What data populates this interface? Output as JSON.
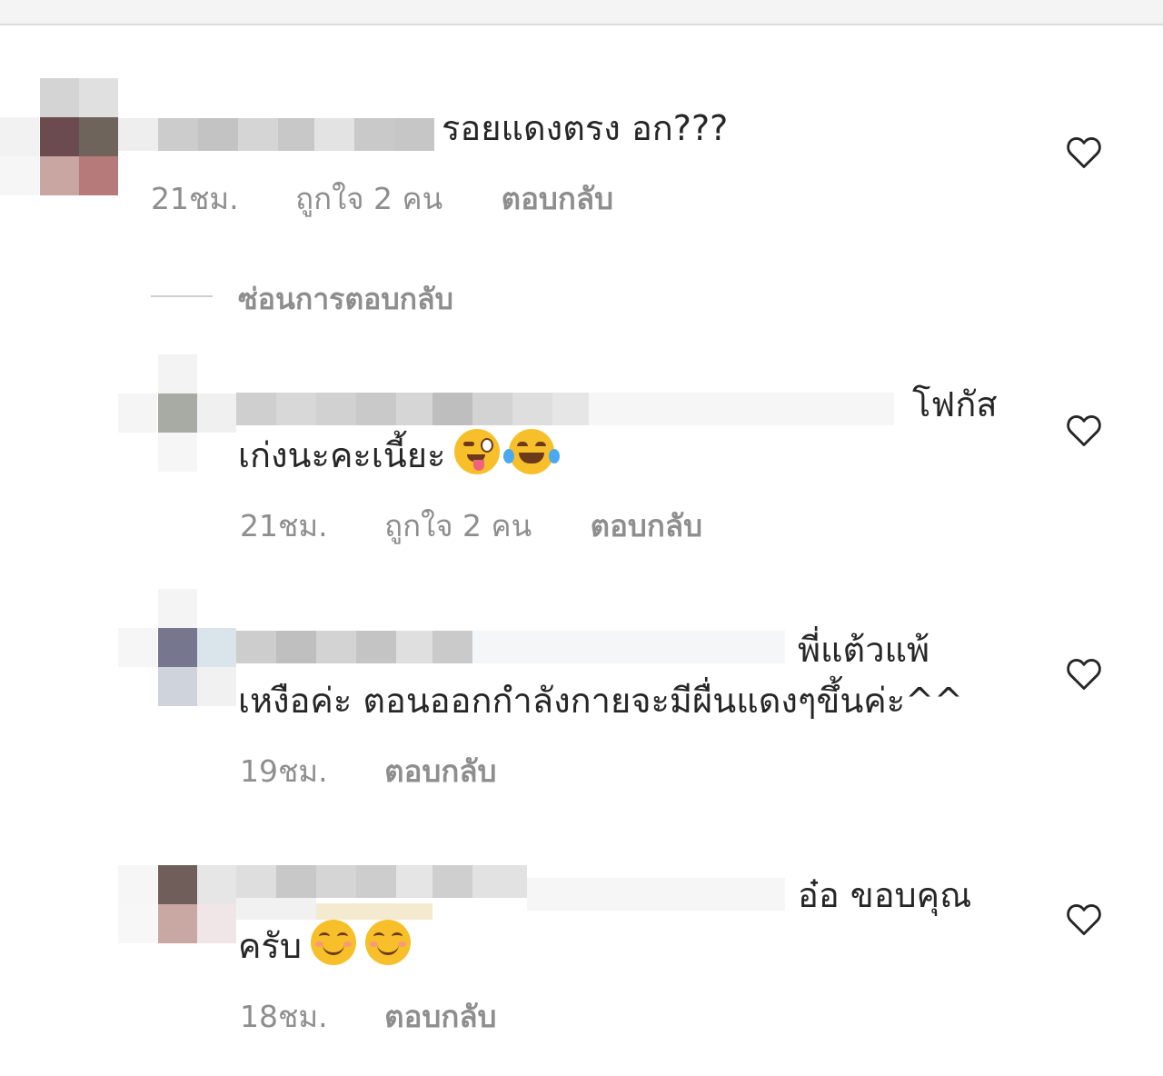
{
  "colors": {
    "text": "#262626",
    "meta": "#8e8e8e",
    "divider": "#cfcfcf",
    "emoji_yellow": "#f7c02a"
  },
  "comments": [
    {
      "text_line1": "รอยแดงตรง อก???",
      "text_line2": "",
      "time": "21ชม.",
      "likes": "ถูกใจ 2 คน",
      "reply": "ตอบกลับ",
      "like_icon": "heart-outline-icon"
    }
  ],
  "hide_replies": "ซ่อนการตอบกลับ",
  "replies": [
    {
      "text_line1": "โฟกัส",
      "text_line2": "เก่งนะคะเนี้ยะ",
      "emojis": [
        "winking-face-with-tongue",
        "face-with-tears-of-joy"
      ],
      "time": "21ชม.",
      "likes": "ถูกใจ 2 คน",
      "reply": "ตอบกลับ"
    },
    {
      "text_line1": "พี่แต้วแพ้",
      "text_line2": "เหงือค่ะ  ตอนออกกำลังกายจะมีผื่นแดงๆขึ้นค่ะ^^",
      "emojis": [],
      "time": "19ชม.",
      "likes": "",
      "reply": "ตอบกลับ"
    },
    {
      "text_line1": "อ๋อ ขอบคุณ",
      "text_line2": "ครับ",
      "emojis": [
        "smiling-face-with-smiling-eyes",
        "smiling-face-with-smiling-eyes"
      ],
      "time": "18ชม.",
      "likes": "",
      "reply": "ตอบกลับ"
    }
  ]
}
